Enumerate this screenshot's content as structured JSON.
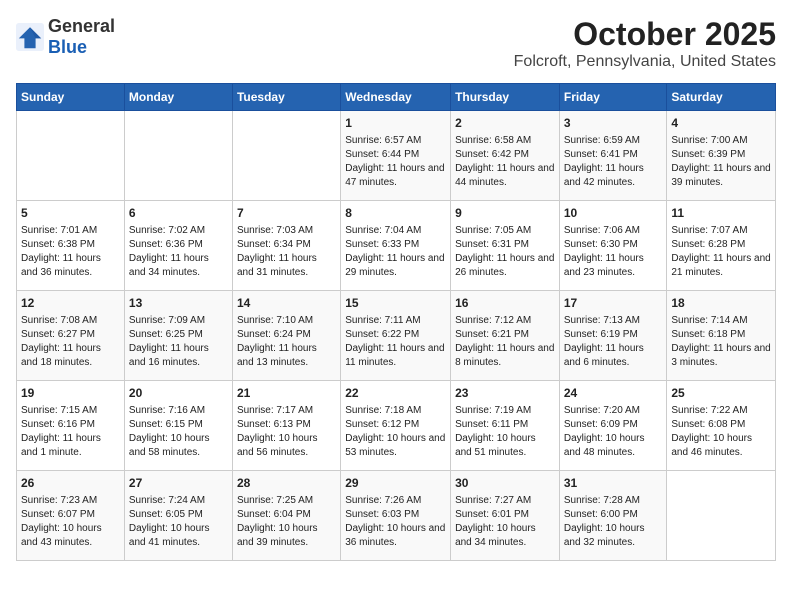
{
  "logo": {
    "general": "General",
    "blue": "Blue"
  },
  "title": "October 2025",
  "subtitle": "Folcroft, Pennsylvania, United States",
  "weekdays": [
    "Sunday",
    "Monday",
    "Tuesday",
    "Wednesday",
    "Thursday",
    "Friday",
    "Saturday"
  ],
  "weeks": [
    [
      {
        "day": "",
        "info": ""
      },
      {
        "day": "",
        "info": ""
      },
      {
        "day": "",
        "info": ""
      },
      {
        "day": "1",
        "info": "Sunrise: 6:57 AM\nSunset: 6:44 PM\nDaylight: 11 hours and 47 minutes."
      },
      {
        "day": "2",
        "info": "Sunrise: 6:58 AM\nSunset: 6:42 PM\nDaylight: 11 hours and 44 minutes."
      },
      {
        "day": "3",
        "info": "Sunrise: 6:59 AM\nSunset: 6:41 PM\nDaylight: 11 hours and 42 minutes."
      },
      {
        "day": "4",
        "info": "Sunrise: 7:00 AM\nSunset: 6:39 PM\nDaylight: 11 hours and 39 minutes."
      }
    ],
    [
      {
        "day": "5",
        "info": "Sunrise: 7:01 AM\nSunset: 6:38 PM\nDaylight: 11 hours and 36 minutes."
      },
      {
        "day": "6",
        "info": "Sunrise: 7:02 AM\nSunset: 6:36 PM\nDaylight: 11 hours and 34 minutes."
      },
      {
        "day": "7",
        "info": "Sunrise: 7:03 AM\nSunset: 6:34 PM\nDaylight: 11 hours and 31 minutes."
      },
      {
        "day": "8",
        "info": "Sunrise: 7:04 AM\nSunset: 6:33 PM\nDaylight: 11 hours and 29 minutes."
      },
      {
        "day": "9",
        "info": "Sunrise: 7:05 AM\nSunset: 6:31 PM\nDaylight: 11 hours and 26 minutes."
      },
      {
        "day": "10",
        "info": "Sunrise: 7:06 AM\nSunset: 6:30 PM\nDaylight: 11 hours and 23 minutes."
      },
      {
        "day": "11",
        "info": "Sunrise: 7:07 AM\nSunset: 6:28 PM\nDaylight: 11 hours and 21 minutes."
      }
    ],
    [
      {
        "day": "12",
        "info": "Sunrise: 7:08 AM\nSunset: 6:27 PM\nDaylight: 11 hours and 18 minutes."
      },
      {
        "day": "13",
        "info": "Sunrise: 7:09 AM\nSunset: 6:25 PM\nDaylight: 11 hours and 16 minutes."
      },
      {
        "day": "14",
        "info": "Sunrise: 7:10 AM\nSunset: 6:24 PM\nDaylight: 11 hours and 13 minutes."
      },
      {
        "day": "15",
        "info": "Sunrise: 7:11 AM\nSunset: 6:22 PM\nDaylight: 11 hours and 11 minutes."
      },
      {
        "day": "16",
        "info": "Sunrise: 7:12 AM\nSunset: 6:21 PM\nDaylight: 11 hours and 8 minutes."
      },
      {
        "day": "17",
        "info": "Sunrise: 7:13 AM\nSunset: 6:19 PM\nDaylight: 11 hours and 6 minutes."
      },
      {
        "day": "18",
        "info": "Sunrise: 7:14 AM\nSunset: 6:18 PM\nDaylight: 11 hours and 3 minutes."
      }
    ],
    [
      {
        "day": "19",
        "info": "Sunrise: 7:15 AM\nSunset: 6:16 PM\nDaylight: 11 hours and 1 minute."
      },
      {
        "day": "20",
        "info": "Sunrise: 7:16 AM\nSunset: 6:15 PM\nDaylight: 10 hours and 58 minutes."
      },
      {
        "day": "21",
        "info": "Sunrise: 7:17 AM\nSunset: 6:13 PM\nDaylight: 10 hours and 56 minutes."
      },
      {
        "day": "22",
        "info": "Sunrise: 7:18 AM\nSunset: 6:12 PM\nDaylight: 10 hours and 53 minutes."
      },
      {
        "day": "23",
        "info": "Sunrise: 7:19 AM\nSunset: 6:11 PM\nDaylight: 10 hours and 51 minutes."
      },
      {
        "day": "24",
        "info": "Sunrise: 7:20 AM\nSunset: 6:09 PM\nDaylight: 10 hours and 48 minutes."
      },
      {
        "day": "25",
        "info": "Sunrise: 7:22 AM\nSunset: 6:08 PM\nDaylight: 10 hours and 46 minutes."
      }
    ],
    [
      {
        "day": "26",
        "info": "Sunrise: 7:23 AM\nSunset: 6:07 PM\nDaylight: 10 hours and 43 minutes."
      },
      {
        "day": "27",
        "info": "Sunrise: 7:24 AM\nSunset: 6:05 PM\nDaylight: 10 hours and 41 minutes."
      },
      {
        "day": "28",
        "info": "Sunrise: 7:25 AM\nSunset: 6:04 PM\nDaylight: 10 hours and 39 minutes."
      },
      {
        "day": "29",
        "info": "Sunrise: 7:26 AM\nSunset: 6:03 PM\nDaylight: 10 hours and 36 minutes."
      },
      {
        "day": "30",
        "info": "Sunrise: 7:27 AM\nSunset: 6:01 PM\nDaylight: 10 hours and 34 minutes."
      },
      {
        "day": "31",
        "info": "Sunrise: 7:28 AM\nSunset: 6:00 PM\nDaylight: 10 hours and 32 minutes."
      },
      {
        "day": "",
        "info": ""
      }
    ]
  ]
}
